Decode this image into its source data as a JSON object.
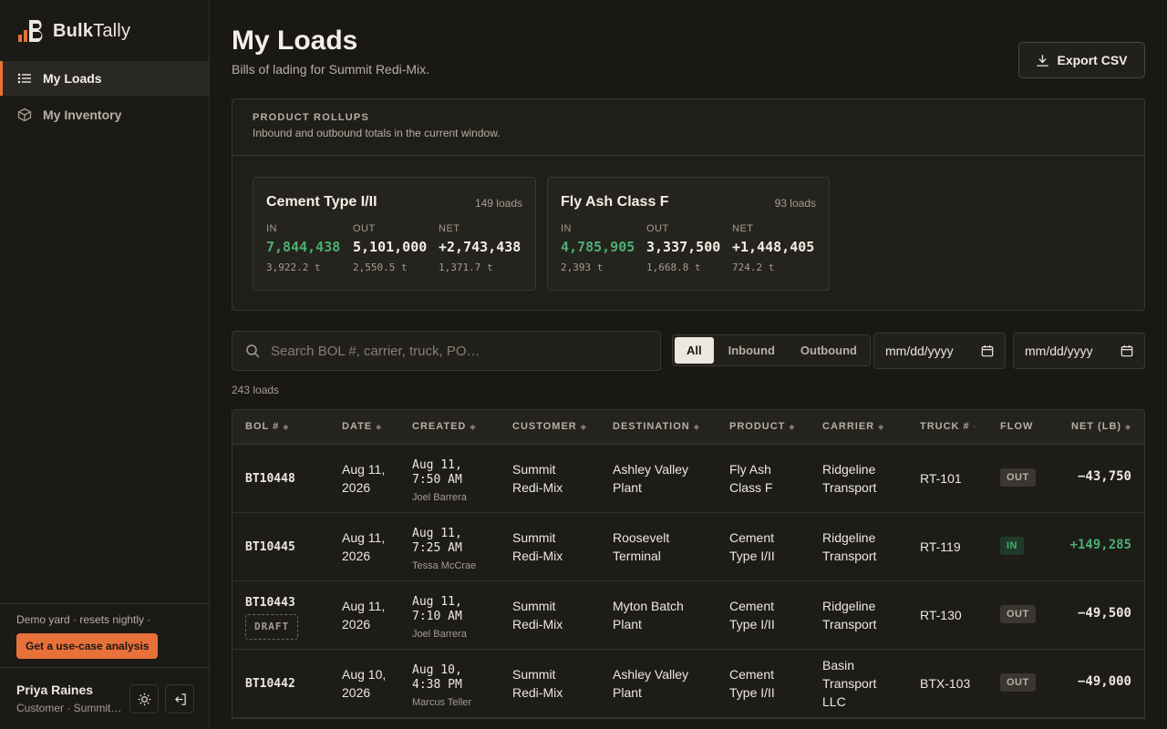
{
  "brand": {
    "name_bold": "Bulk",
    "name_rest": "Tally"
  },
  "nav": [
    {
      "label": "My Loads",
      "icon": "list-icon",
      "active": true
    },
    {
      "label": "My Inventory",
      "icon": "box-icon",
      "active": false
    }
  ],
  "demo": {
    "text": "Demo yard · resets nightly ·",
    "cta": "Get a use-case analysis"
  },
  "user": {
    "name": "Priya Raines",
    "role": "Customer · Summit Redi-Mix"
  },
  "header": {
    "title": "My Loads",
    "subtitle": "Bills of lading for Summit Redi-Mix.",
    "export_label": "Export CSV"
  },
  "rollups": {
    "label": "PRODUCT ROLLUPS",
    "description": "Inbound and outbound totals in the current window.",
    "labels": {
      "in": "IN",
      "out": "OUT",
      "net": "NET"
    },
    "cards": [
      {
        "name": "Cement Type I/II",
        "count": "149 loads",
        "in": "7,844,438",
        "in_t": "3,922.2 t",
        "out": "5,101,000",
        "out_t": "2,550.5 t",
        "net": "+2,743,438",
        "net_t": "1,371.7 t"
      },
      {
        "name": "Fly Ash Class F",
        "count": "93 loads",
        "in": "4,785,905",
        "in_t": "2,393 t",
        "out": "3,337,500",
        "out_t": "1,668.8 t",
        "net": "+1,448,405",
        "net_t": "724.2 t"
      }
    ]
  },
  "filters": {
    "search_placeholder": "Search BOL #, carrier, truck, PO…",
    "segments": [
      "All",
      "Inbound",
      "Outbound"
    ],
    "active_segment": "All",
    "date_from": "mm/dd/yyyy",
    "date_to": "mm/dd/yyyy",
    "count": "243 loads"
  },
  "table": {
    "columns": [
      "BOL #",
      "DATE",
      "CREATED",
      "CUSTOMER",
      "DESTINATION",
      "PRODUCT",
      "CARRIER",
      "TRUCK #",
      "FLOW",
      "NET (LB)"
    ],
    "rows": [
      {
        "bol": "BT10448",
        "draft": "",
        "date1": "Aug 11,",
        "date2": "2026",
        "created1": "Aug 11,",
        "created2": "7:50 AM",
        "created_by": "Joel Barrera",
        "customer1": "Summit",
        "customer2": "Redi-Mix",
        "dest1": "Ashley Valley",
        "dest2": "Plant",
        "product1": "Fly Ash",
        "product2": "Class F",
        "carrier1": "Ridgeline",
        "carrier2": "Transport",
        "carrier3": "",
        "truck": "RT-101",
        "flow": "OUT",
        "net": "−43,750"
      },
      {
        "bol": "BT10445",
        "draft": "",
        "date1": "Aug 11,",
        "date2": "2026",
        "created1": "Aug 11,",
        "created2": "7:25 AM",
        "created_by": "Tessa McCrae",
        "customer1": "Summit",
        "customer2": "Redi-Mix",
        "dest1": "Roosevelt",
        "dest2": "Terminal",
        "product1": "Cement",
        "product2": "Type I/II",
        "carrier1": "Ridgeline",
        "carrier2": "Transport",
        "carrier3": "",
        "truck": "RT-119",
        "flow": "IN",
        "net": "+149,285"
      },
      {
        "bol": "BT10443",
        "draft": "DRAFT",
        "date1": "Aug 11,",
        "date2": "2026",
        "created1": "Aug 11,",
        "created2": "7:10 AM",
        "created_by": "Joel Barrera",
        "customer1": "Summit",
        "customer2": "Redi-Mix",
        "dest1": "Myton Batch",
        "dest2": "Plant",
        "product1": "Cement",
        "product2": "Type I/II",
        "carrier1": "Ridgeline",
        "carrier2": "Transport",
        "carrier3": "",
        "truck": "RT-130",
        "flow": "OUT",
        "net": "−49,500"
      },
      {
        "bol": "BT10442",
        "draft": "",
        "date1": "Aug 10,",
        "date2": "2026",
        "created1": "Aug 10,",
        "created2": "4:38 PM",
        "created_by": "Marcus Teller",
        "customer1": "Summit",
        "customer2": "Redi-Mix",
        "dest1": "Ashley Valley",
        "dest2": "Plant",
        "product1": "Cement",
        "product2": "Type I/II",
        "carrier1": "Basin",
        "carrier2": "Transport",
        "carrier3": "LLC",
        "truck": "BTX-103",
        "flow": "OUT",
        "net": "−49,000"
      }
    ]
  },
  "colors": {
    "accent": "#e8713a",
    "positive": "#4caf74",
    "background": "#1a1814"
  }
}
